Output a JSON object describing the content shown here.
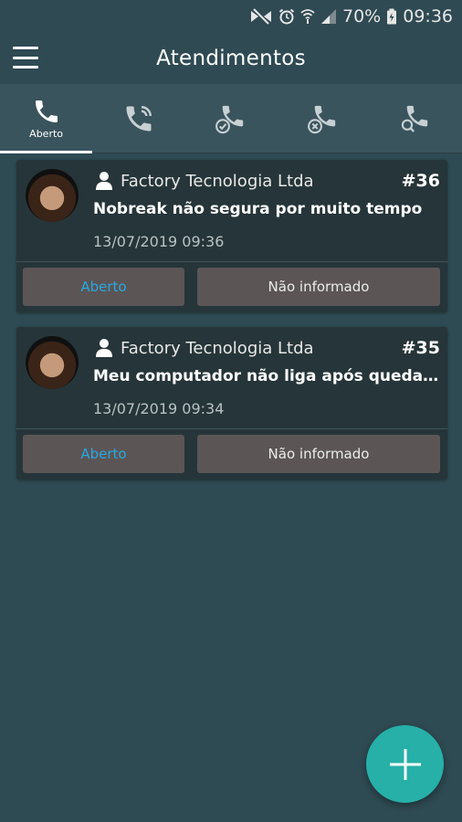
{
  "status_bar": {
    "battery": "70%",
    "time": "09:36",
    "icons": [
      "mute-icon",
      "alarm-icon",
      "wifi-icon",
      "signal-icon",
      "battery-icon"
    ]
  },
  "app_bar": {
    "title": "Atendimentos",
    "menu_icon": "hamburger-menu-icon"
  },
  "tabs": [
    {
      "icon": "phone-icon",
      "label": "Aberto",
      "active": true
    },
    {
      "icon": "phone-ringing-icon",
      "label": "",
      "active": false
    },
    {
      "icon": "phone-check-icon",
      "label": "",
      "active": false
    },
    {
      "icon": "phone-cancel-icon",
      "label": "",
      "active": false
    },
    {
      "icon": "phone-search-icon",
      "label": "",
      "active": false
    }
  ],
  "tickets": [
    {
      "company": "Factory Tecnologia Ltda",
      "number": "#36",
      "subject": "Nobreak não segura por muito tempo",
      "date": "13/07/2019 09:36",
      "status": "Aberto",
      "priority": "Não informado"
    },
    {
      "company": "Factory Tecnologia Ltda",
      "number": "#35",
      "subject": "Meu computador não liga após queda de...",
      "date": "13/07/2019 09:34",
      "status": "Aberto",
      "priority": "Não informado"
    }
  ],
  "fab": {
    "icon": "plus-icon"
  },
  "colors": {
    "background": "#2e4a52",
    "card": "#263539",
    "badge": "#5b5556",
    "status_text": "#29a8e0",
    "fab": "#26b0a8"
  }
}
